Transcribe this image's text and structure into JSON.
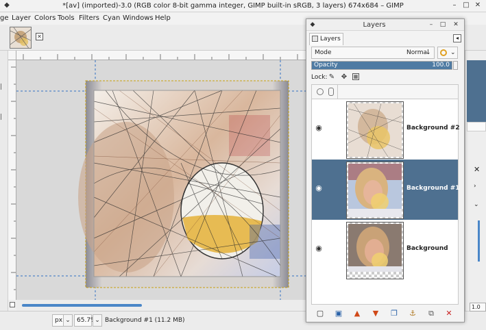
{
  "window": {
    "title": "*[av] (imported)-3.0 (RGB color 8-bit gamma integer, GIMP built-in sRGB, 3 layers) 674x684 – GIMP"
  },
  "menubar": {
    "items": [
      {
        "label": "ge"
      },
      {
        "label": "Layer"
      },
      {
        "label": "Colors"
      },
      {
        "label": "Tools"
      },
      {
        "label": "Filters"
      },
      {
        "label": "Cyan"
      },
      {
        "label": "Windows"
      },
      {
        "label": "Help"
      }
    ]
  },
  "statusbar": {
    "unit": "px",
    "zoom": "65.7%",
    "info": "Background #1 (11.2 MB)"
  },
  "right_edge": {
    "value": "1.0"
  },
  "layers_dialog": {
    "title": "Layers",
    "tab_label": "Layers",
    "mode_label": "Mode",
    "mode_value": "Normal",
    "opacity_label": "Opacity",
    "opacity_value": "100.0",
    "opacity_fraction": 1.0,
    "lock_label": "Lock:",
    "layers": [
      {
        "name": "Background #2",
        "visible": true,
        "selected": false
      },
      {
        "name": "Background #1",
        "visible": true,
        "selected": true
      },
      {
        "name": "Background",
        "visible": true,
        "selected": false
      }
    ]
  },
  "colors": {
    "selection": "#4e7090",
    "opacity_fill": "#4f7ba3",
    "toolbar_icon": "#2a62a8",
    "delete_icon": "#c82020"
  }
}
